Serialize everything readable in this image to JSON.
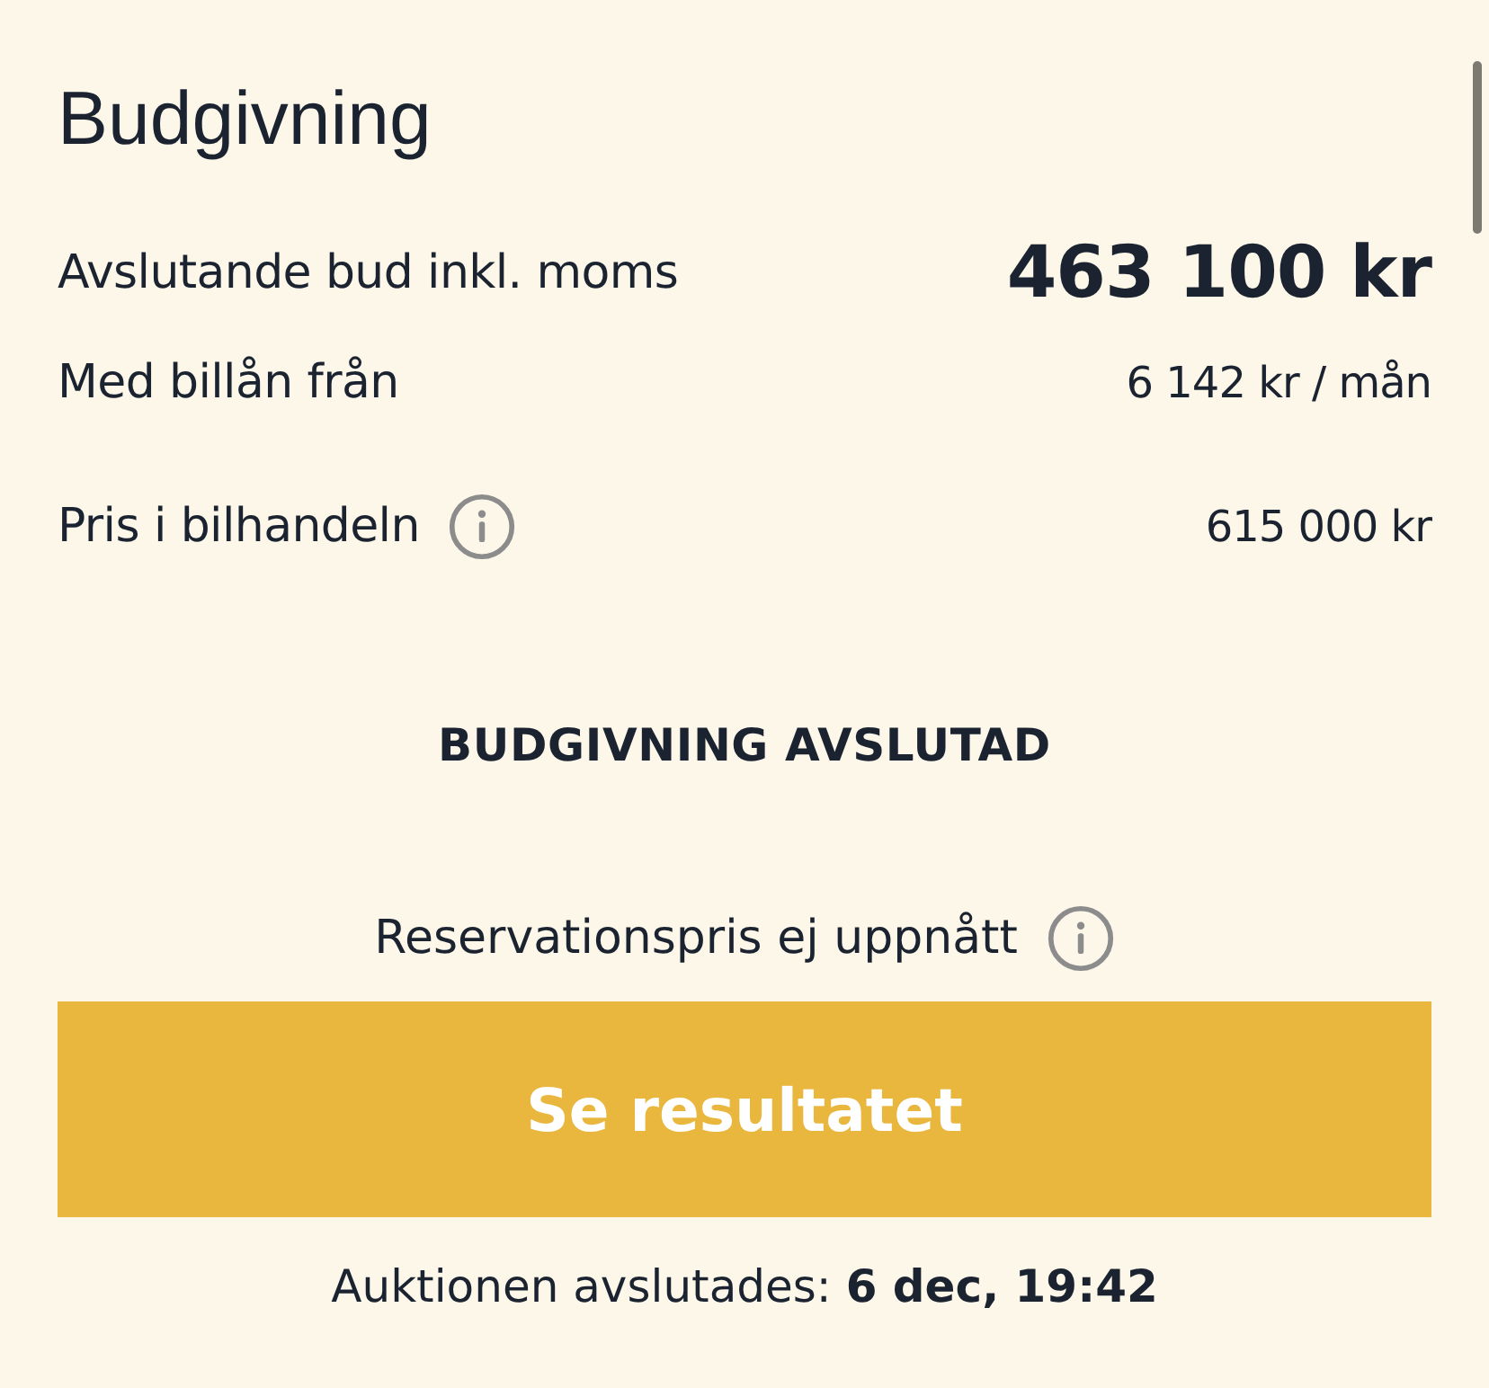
{
  "heading": "Budgivning",
  "price_rows": [
    {
      "kind": "highlight",
      "label": "Avslutande bud inkl. moms",
      "value": "463 100 kr",
      "info": false
    },
    {
      "kind": "plain",
      "label": "Med billån från",
      "value": "6 142 kr / mån",
      "info": false
    },
    {
      "kind": "plain",
      "label": "Pris i bilhandeln",
      "value": "615 000 kr",
      "info": true
    }
  ],
  "status": "BUDGIVNING AVSLUTAD",
  "reserve": {
    "text": "Reservationspris ej uppnått",
    "info": true
  },
  "button": {
    "label": "Se resultatet"
  },
  "footer": "Auktionen avslutades: **6 dec, 19:42**"
}
